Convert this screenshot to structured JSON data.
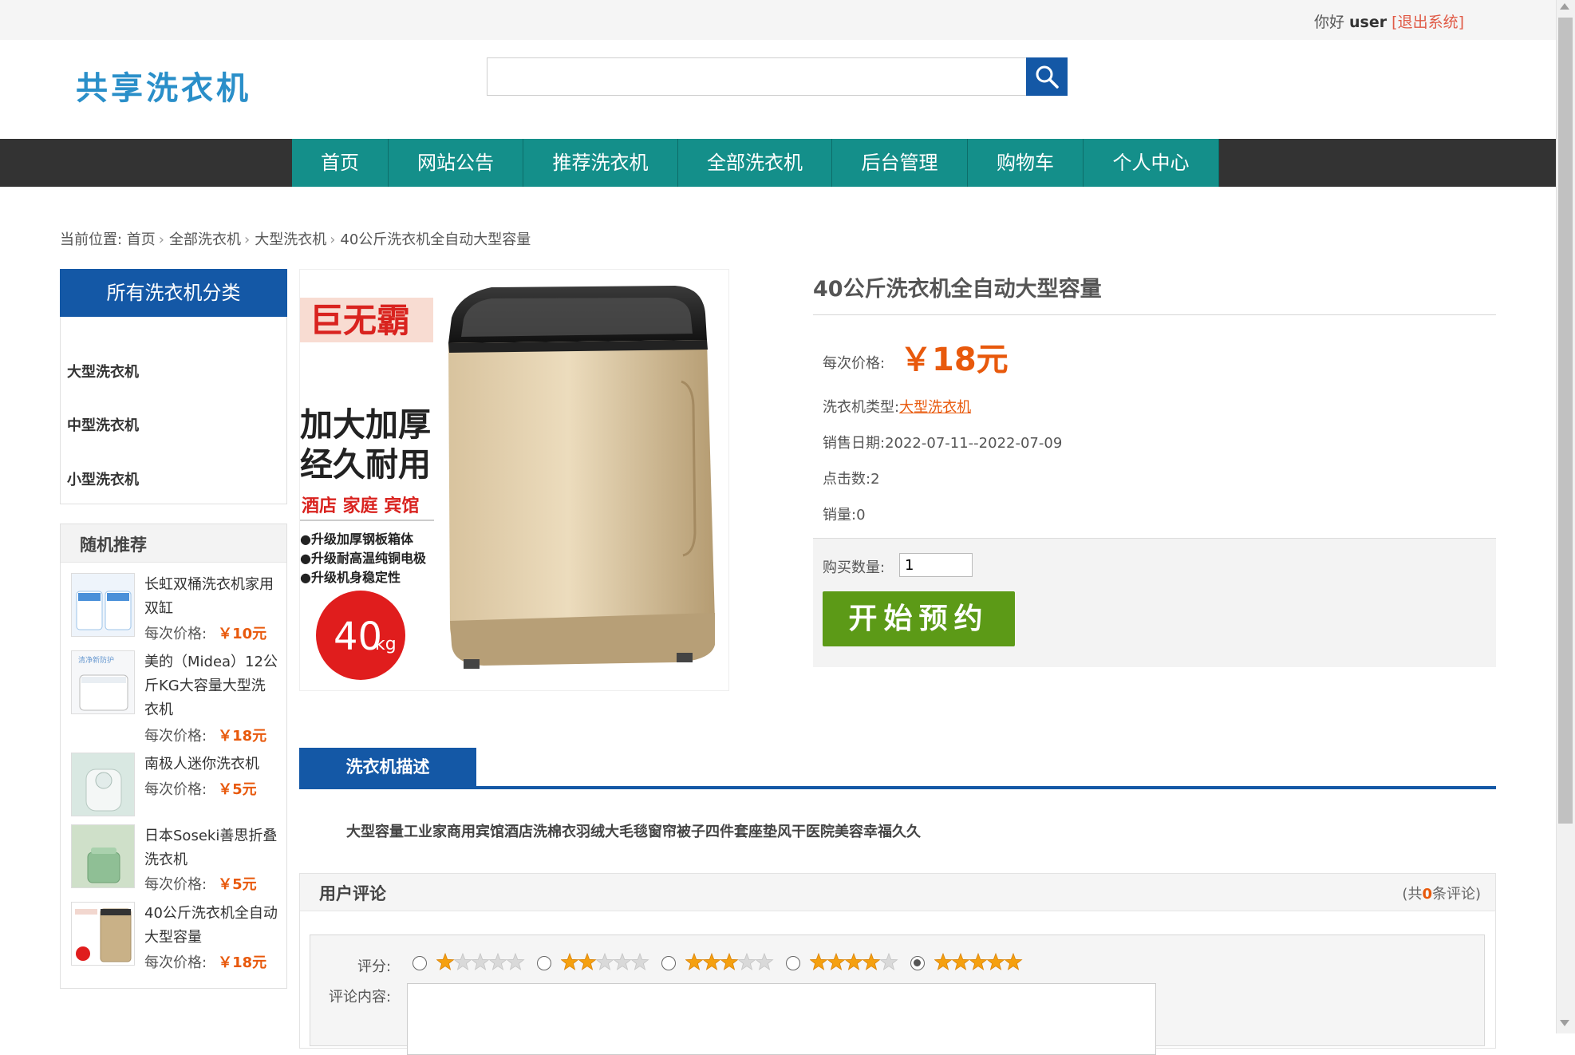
{
  "topbar": {
    "greeting": "你好",
    "username": "user",
    "logout": "[退出系统]"
  },
  "header": {
    "logo": "共享洗衣机",
    "search_placeholder": ""
  },
  "nav": [
    "首页",
    "网站公告",
    "推荐洗衣机",
    "全部洗衣机",
    "后台管理",
    "购物车",
    "个人中心"
  ],
  "breadcrumb": {
    "prefix": "当前位置: ",
    "items": [
      "首页",
      "全部洗衣机",
      "大型洗衣机",
      "40公斤洗衣机全自动大型容量"
    ]
  },
  "sidebar": {
    "categories_title": "所有洗衣机分类",
    "categories": [
      "大型洗衣机",
      "中型洗衣机",
      "小型洗衣机"
    ],
    "recommend_title": "随机推荐",
    "price_label": "每次价格:",
    "recommend": [
      {
        "name": "长虹双桶洗衣机家用双缸",
        "price": "￥10元"
      },
      {
        "name": "美的（Midea）12公斤KG大容量大型洗衣机",
        "price": "￥18元"
      },
      {
        "name": "南极人迷你洗衣机",
        "price": "￥5元"
      },
      {
        "name": "日本Soseki善思折叠洗衣机",
        "price": "￥5元"
      },
      {
        "name": "40公斤洗衣机全自动大型容量",
        "price": "￥18元"
      }
    ]
  },
  "product": {
    "image_text": {
      "badge": "巨无霸",
      "line1": "加大加厚",
      "line2": "经久耐用",
      "tags": "酒店 家庭 宾馆",
      "bullets": [
        "●升级加厚钢板箱体",
        "●升级耐高温纯铜电极",
        "●升级机身稳定性"
      ],
      "capacity": "40",
      "unit": "kg"
    },
    "title": "40公斤洗衣机全自动大型容量",
    "price_label": "每次价格:",
    "price": "￥18元",
    "type_label": "洗衣机类型:",
    "type": "大型洗衣机",
    "date_label": "销售日期:",
    "date": "2022-07-11--2022-07-09",
    "clicks_label": "点击数:",
    "clicks": "2",
    "sales_label": "销量:",
    "sales": "0",
    "qty_label": "购买数量:",
    "qty": "1",
    "book_button": "开始预约"
  },
  "description": {
    "tab": "洗衣机描述",
    "text": "大型容量工业家商用宾馆酒店洗棉衣羽绒大毛毯窗帘被子四件套座垫风干医院美容幸福久久"
  },
  "comments": {
    "title": "用户评论",
    "count_prefix": "(共",
    "count": "0",
    "count_suffix": "条评论)",
    "rating_label": "评分:",
    "content_label": "评论内容:",
    "ratings": [
      1,
      2,
      3,
      4,
      5
    ],
    "selected_rating": 5
  },
  "colors": {
    "nav_bg": "#148f8a",
    "brand_blue": "#1458a6",
    "price": "#e8590c",
    "book_button": "#5c9a17"
  }
}
